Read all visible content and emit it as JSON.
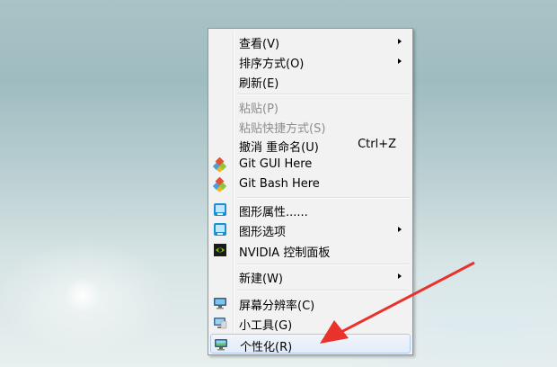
{
  "context_menu": {
    "items": [
      {
        "label": "查看(V)",
        "submenu": true
      },
      {
        "label": "排序方式(O)",
        "submenu": true
      },
      {
        "label": "刷新(E)"
      },
      {
        "label": "粘贴(P)",
        "disabled": true
      },
      {
        "label": "粘贴快捷方式(S)",
        "disabled": true
      },
      {
        "label": "撤消 重命名(U)",
        "shortcut": "Ctrl+Z"
      },
      {
        "label": "Git GUI Here",
        "icon": "git-icon"
      },
      {
        "label": "Git Bash Here",
        "icon": "git-icon"
      },
      {
        "label": "图形属性......",
        "icon": "intel-graphics-icon"
      },
      {
        "label": "图形选项",
        "icon": "intel-graphics-icon",
        "submenu": true
      },
      {
        "label": "NVIDIA 控制面板",
        "icon": "nvidia-icon"
      },
      {
        "label": "新建(W)",
        "submenu": true
      },
      {
        "label": "屏幕分辨率(C)",
        "icon": "monitor-icon"
      },
      {
        "label": "小工具(G)",
        "icon": "gadgets-icon"
      },
      {
        "label": "个性化(R)",
        "icon": "personalize-icon",
        "highlighted": true
      }
    ]
  },
  "annotation": {
    "color": "#e8322b"
  }
}
